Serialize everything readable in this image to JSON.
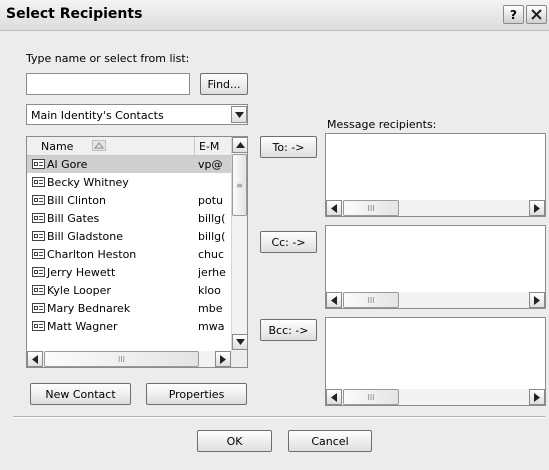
{
  "title": "Select Recipients",
  "help_label": "?",
  "type_name_label": "Type name or select from list:",
  "search": {
    "value": ""
  },
  "find_button": "Find...",
  "address_book": {
    "selected": "Main Identity's Contacts"
  },
  "columns": {
    "name": "Name",
    "email": "E-M"
  },
  "contacts": [
    {
      "name": "Al Gore",
      "email": "vp@"
    },
    {
      "name": "Becky Whitney",
      "email": ""
    },
    {
      "name": "Bill Clinton",
      "email": "potu"
    },
    {
      "name": "Bill Gates",
      "email": "billg("
    },
    {
      "name": "Bill Gladstone",
      "email": "billg("
    },
    {
      "name": "Charlton Heston",
      "email": "chuc"
    },
    {
      "name": "Jerry Hewett",
      "email": "jerhe"
    },
    {
      "name": "Kyle Looper",
      "email": "kloo"
    },
    {
      "name": "Mary Bednarek",
      "email": "mbe"
    },
    {
      "name": "Matt Wagner",
      "email": "mwa"
    }
  ],
  "selected_contact_index": 0,
  "message_recipients_label": "Message recipients:",
  "to_button": "To: ->",
  "cc_button": "Cc: ->",
  "bcc_button": "Bcc: ->",
  "new_contact_button": "New Contact",
  "properties_button": "Properties",
  "ok_button": "OK",
  "cancel_button": "Cancel"
}
